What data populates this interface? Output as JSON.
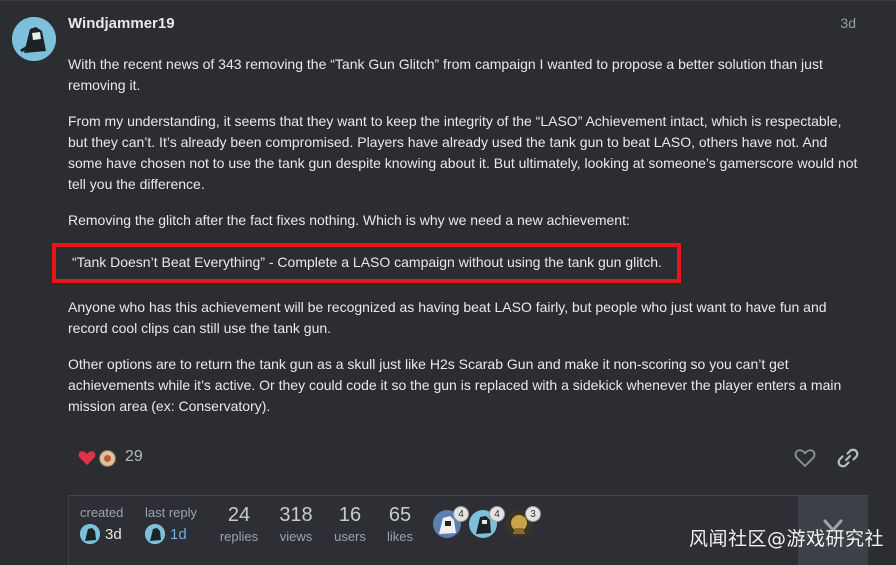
{
  "post": {
    "username": "Windjammer19",
    "date": "3d",
    "paragraphs": [
      "With the recent news of 343 removing the “Tank Gun Glitch” from campaign I wanted to propose a better solution than just removing it.",
      "From my understanding, it seems that they want to keep the integrity of the “LASO” Achievement intact, which is respectable, but they can’t. It’s already been compromised. Players have already used the tank gun to beat LASO, others have not. And some have chosen not to use the tank gun despite knowing about it. But ultimately, looking at someone’s gamerscore would not tell you the difference.",
      "Removing the glitch after the fact fixes nothing. Which is why we need a new achievement:",
      "“Tank Doesn’t Beat Everything” - Complete a LASO campaign without using the tank gun glitch.",
      "Anyone who has this achievement will be recognized as having beat LASO fairly, but people who just want to have fun and record cool clips can still use the tank gun.",
      "Other options are to return the tank gun as a skull just like H2s Scarab Gun and make it non-scoring so you can’t get achievements while it’s active. Or they could code it so the gun is replaced with a sidekick whenever the player enters a main mission area (ex: Conservatory)."
    ],
    "highlight_color": "#e5161d"
  },
  "actions": {
    "reaction_count": "29",
    "heart_icon": "heart-icon",
    "like_icon": "heart-outline-icon",
    "link_icon": "link-icon"
  },
  "topic_map": {
    "created_label": "created",
    "created_value": "3d",
    "last_reply_label": "last reply",
    "last_reply_value": "1d",
    "stats": [
      {
        "number": "24",
        "label": "replies"
      },
      {
        "number": "318",
        "label": "views"
      },
      {
        "number": "16",
        "label": "users"
      },
      {
        "number": "65",
        "label": "likes"
      }
    ],
    "participants": [
      {
        "count": "4"
      },
      {
        "count": "4"
      },
      {
        "count": "3"
      }
    ]
  },
  "watermark": "风闻社区@游戏研究社"
}
